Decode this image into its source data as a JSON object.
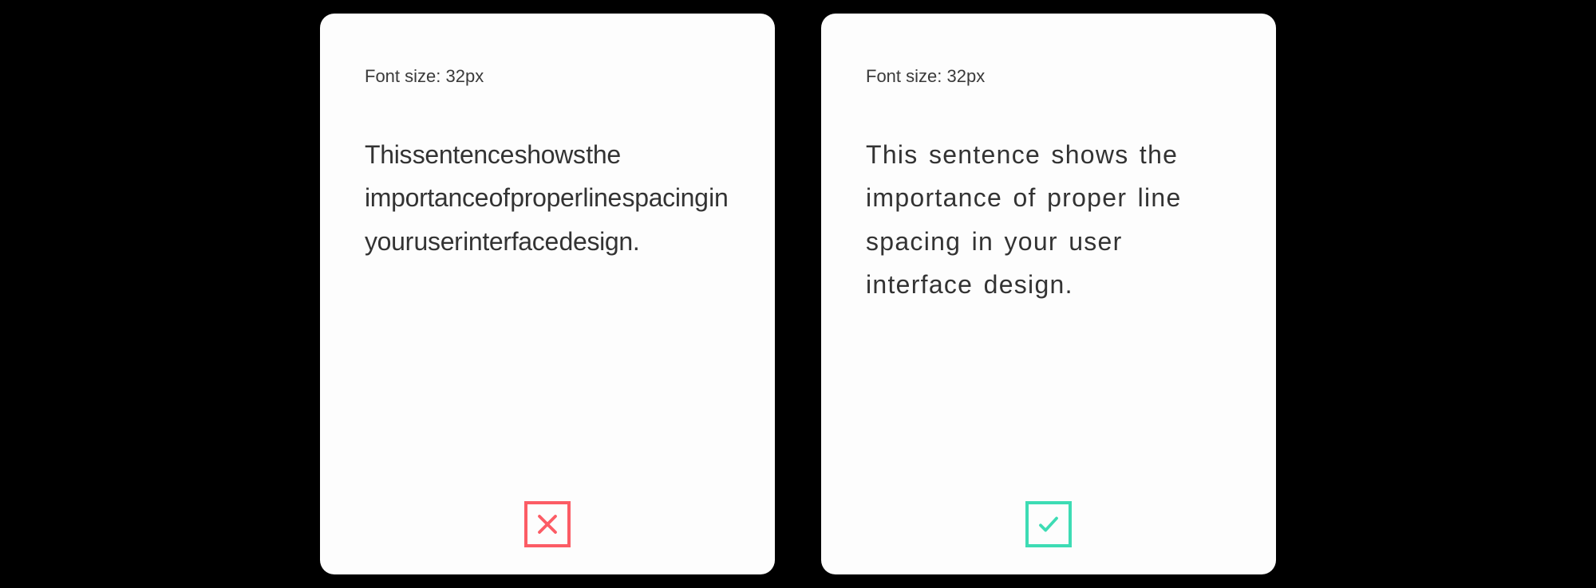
{
  "colors": {
    "error": "#FC5C65",
    "success": "#3DDCB4"
  },
  "cards": [
    {
      "label": "Font size: 32px",
      "body": "This sentence shows the importance of proper line spacing in your user interface design.",
      "status": "bad"
    },
    {
      "label": "Font size: 32px",
      "body": "This sentence shows the importance of proper line spacing in your user interface design.",
      "status": "good"
    }
  ]
}
